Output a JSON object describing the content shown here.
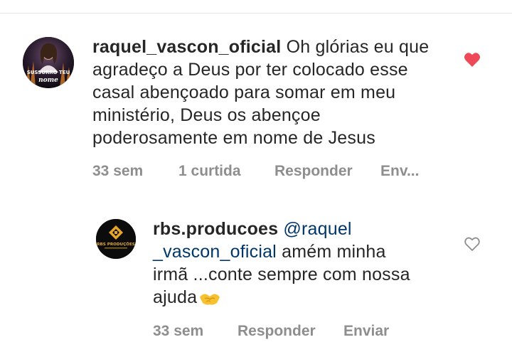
{
  "comments": [
    {
      "username": "raquel_vascon_oficial",
      "text": "Oh glórias eu que agradeço a Deus por ter colocado esse casal abençoado para somar em meu ministério, Deus os abençoe poderosamente em nome de Jesus",
      "avatar_text": {
        "line1": "SUSSURRO TEU",
        "line2": "nome"
      },
      "time": "33 sem",
      "likes": "1 curtida",
      "reply_label": "Responder",
      "send_label": "Env...",
      "liked": true,
      "heart_color": "#ed4956",
      "icon": "heart-filled-icon"
    },
    {
      "username": "rbs.producoes",
      "mention": "@raquel_vascon_oficial",
      "mention_line1": "@raquel",
      "mention_line2": "_vascon_oficial",
      "text_after_mention": "amém minha",
      "text_line3": "irmã ...conte sempre com nossa",
      "text_line4": "ajuda",
      "emoji": "handshake-emoji",
      "avatar_text": {
        "line1": "RBS PRODUÇÕES"
      },
      "time": "33 sem",
      "reply_label": "Responder",
      "send_label": "Enviar",
      "liked": false,
      "heart_color": "#8e8e8e",
      "icon": "heart-outline-icon"
    }
  ],
  "colors": {
    "text": "#262626",
    "secondary": "#8e8e8e",
    "mention": "#00376b",
    "like": "#ed4956"
  }
}
